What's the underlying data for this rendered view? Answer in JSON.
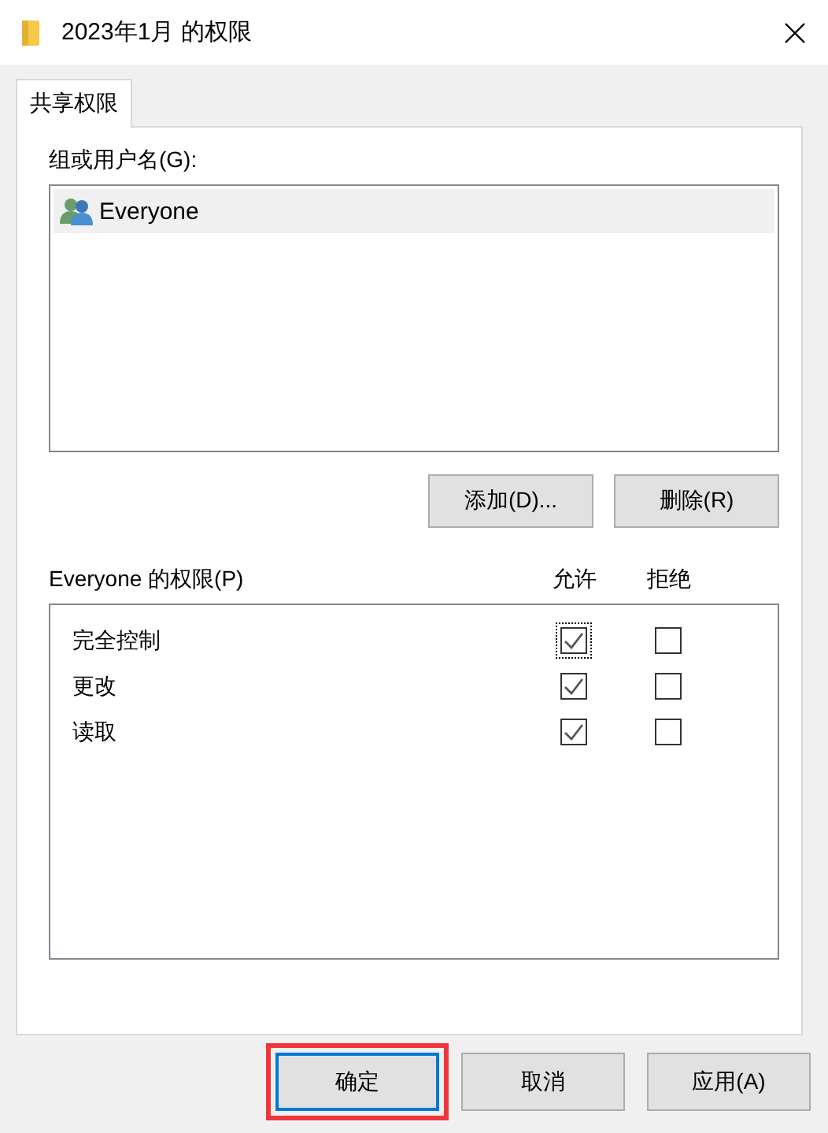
{
  "window": {
    "title": "2023年1月 的权限"
  },
  "tabs": [
    {
      "label": "共享权限",
      "selected": true
    }
  ],
  "groups": {
    "label": "组或用户名(G):",
    "items": [
      {
        "name": "Everyone",
        "selected": true
      }
    ]
  },
  "group_buttons": [
    "添加(D)...",
    "删除(R)"
  ],
  "permissions": {
    "label": "Everyone 的权限(P)",
    "allow_header": "允许",
    "deny_header": "拒绝",
    "rows": [
      {
        "name": "完全控制",
        "allow": true,
        "deny": false,
        "focused": true
      },
      {
        "name": "更改",
        "allow": true,
        "deny": false,
        "focused": false
      },
      {
        "name": "读取",
        "allow": true,
        "deny": false,
        "focused": false
      }
    ]
  },
  "buttons": [
    {
      "label": "确定",
      "default": true,
      "highlighted": true
    },
    {
      "label": "取消",
      "default": false,
      "highlighted": false
    },
    {
      "label": "应用(A)",
      "default": false,
      "highlighted": false
    }
  ]
}
